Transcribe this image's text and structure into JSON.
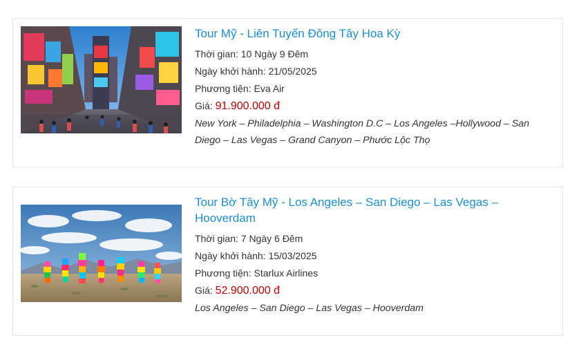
{
  "tours": [
    {
      "title": "Tour Mỹ - Liên Tuyến Đông Tây Hoa Kỳ",
      "duration": "Thời gian: 10 Ngày 9 Đêm",
      "departure": "Ngày khởi hành: 21/05/2025",
      "transport": "Phương tiện: Eva Air",
      "price_label": "Giá:",
      "price": "91.900.000 đ",
      "route": "New York – Philadelphia – Washington D.C – Los Angeles –Hollywood – San Diego – Las Vegas – Grand Canyon – Phước Lộc Thọ"
    },
    {
      "title": "Tour Bờ Tây Mỹ - Los Angeles – San Diego – Las Vegas – Hooverdam",
      "duration": "Thời gian: 7 Ngày 6 Đêm",
      "departure": "Ngày khởi hành: 15/03/2025",
      "transport": "Phương tiện: Starlux Airlines",
      "price_label": "Giá:",
      "price": "52.900.000 đ",
      "route": "Los Angeles – San Diego – Las Vegas – Hooverdam"
    }
  ],
  "colors": {
    "title": "#1a8fd8",
    "price": "#c40000",
    "text": "#333333",
    "border": "#e6e6e6"
  }
}
